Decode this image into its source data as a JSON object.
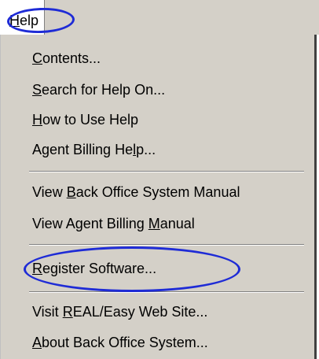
{
  "menubar": {
    "help": {
      "pre": "",
      "acc": "H",
      "post": "elp"
    }
  },
  "menu": {
    "items": [
      {
        "pre": "",
        "acc": "C",
        "post": "ontents..."
      },
      {
        "pre": "",
        "acc": "S",
        "post": "earch for Help On..."
      },
      {
        "pre": "",
        "acc": "H",
        "post": "ow to Use Help"
      },
      {
        "pre": "Agent Billing He",
        "acc": "l",
        "post": "p..."
      },
      {
        "pre": "View ",
        "acc": "B",
        "post": "ack Office System Manual"
      },
      {
        "pre": "View Agent Billing ",
        "acc": "M",
        "post": "anual"
      },
      {
        "pre": "",
        "acc": "R",
        "post": "egister Software..."
      },
      {
        "pre": "Visit ",
        "acc": "R",
        "post": "EAL/Easy Web Site..."
      },
      {
        "pre": "",
        "acc": "A",
        "post": "bout Back Office System..."
      }
    ]
  },
  "colors": {
    "menu_background": "#d4d0c8",
    "highlight_annotation": "#1e2bd6"
  }
}
